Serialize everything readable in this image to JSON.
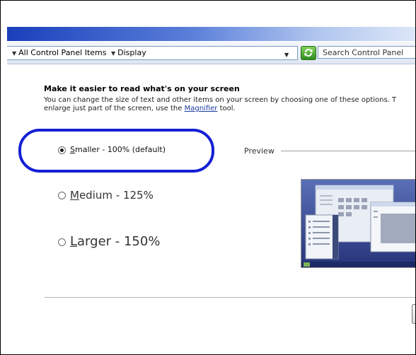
{
  "toolbar": {
    "breadcrumb_all": "All Control Panel Items",
    "breadcrumb_display": "Display",
    "search_placeholder": "Search Control Panel"
  },
  "content": {
    "heading": "Make it easier to read what's on your screen",
    "desc_line1": "You can change the size of text and other items on your screen by choosing one of these options. T",
    "desc_line2_pre": "enlarge just part of the screen, use the ",
    "desc_link": "Magnifier",
    "desc_line2_post": " tool.",
    "options": [
      {
        "accel": "S",
        "rest": "maller - 100% (default)",
        "checked": true
      },
      {
        "accel": "M",
        "rest": "edium - 125%",
        "checked": false
      },
      {
        "accel": "L",
        "rest": "arger - 150%",
        "checked": false
      }
    ],
    "preview_label": "Preview"
  },
  "colors": {
    "highlight": "#1520d4",
    "titlebar": "#1a3fbb"
  }
}
